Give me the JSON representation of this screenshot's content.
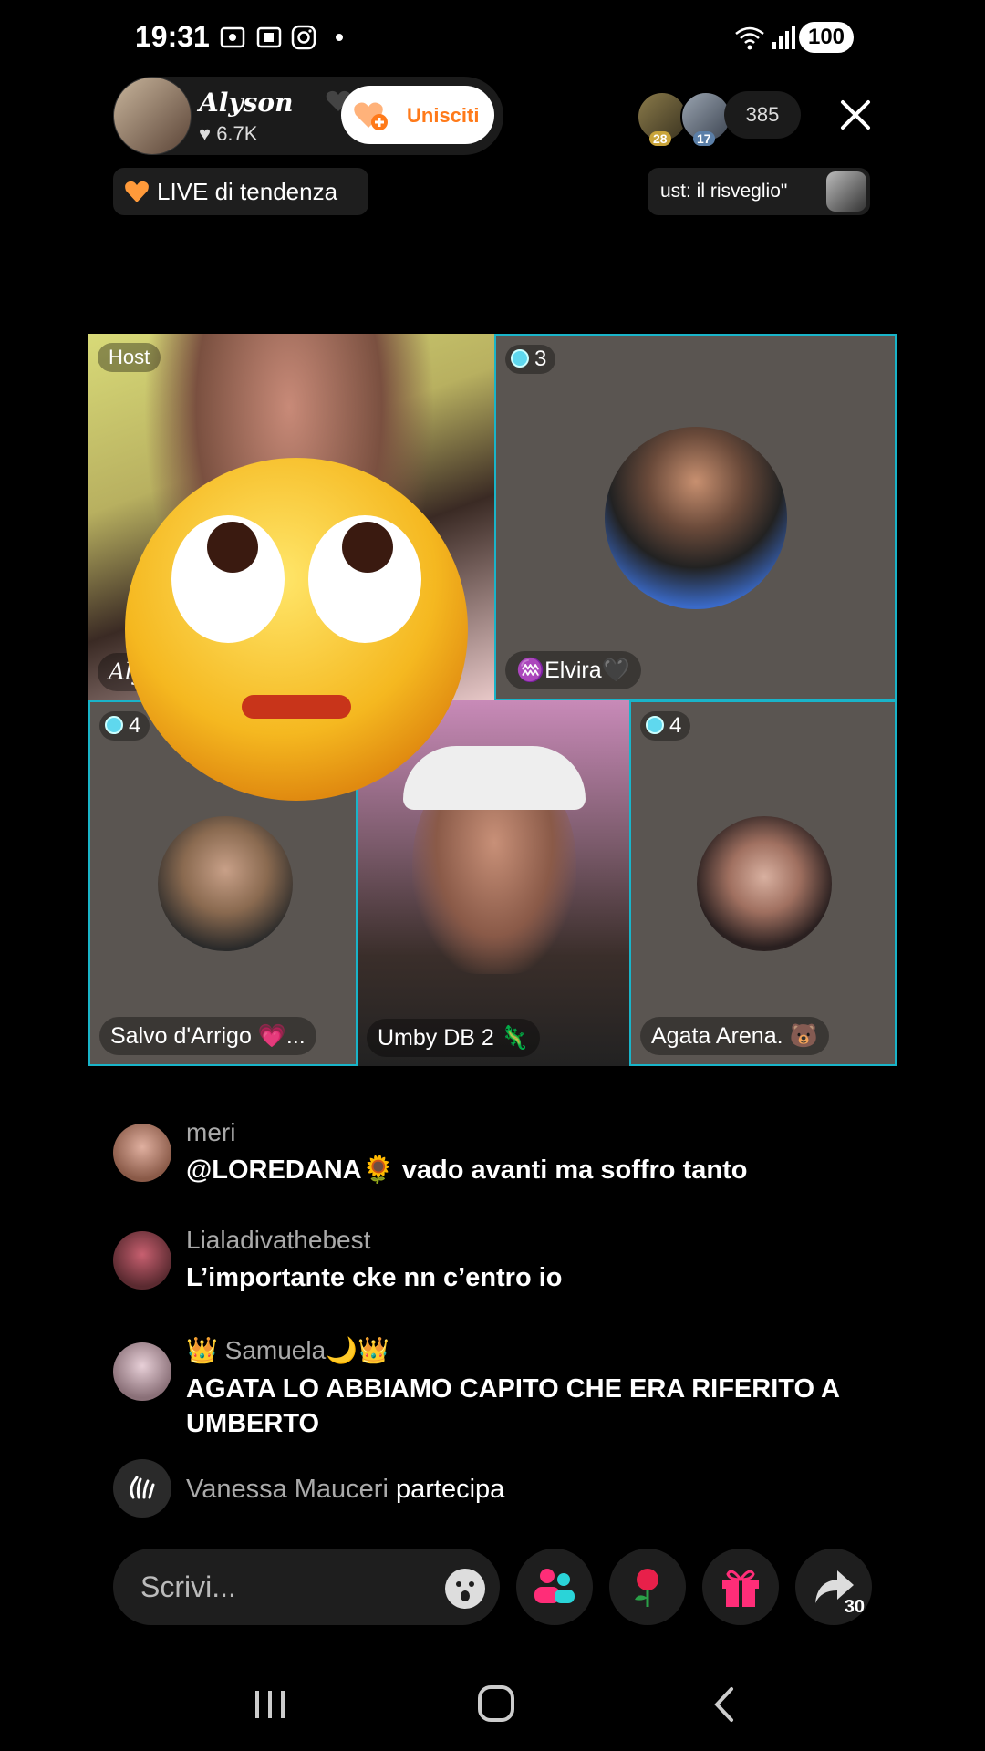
{
  "status_bar": {
    "time": "19:31",
    "battery": "100"
  },
  "host": {
    "name": "Alyson",
    "likes": "6.7K",
    "join_label": "Unisciti"
  },
  "viewers": {
    "avatars": [
      {
        "badge": "28",
        "badge_color": "#c9a43a"
      },
      {
        "badge": "17",
        "badge_color": "#5b7fa8"
      }
    ],
    "count": "385"
  },
  "tags": {
    "trending": "LIVE di tendenza",
    "live_title": "ust: il risveglio\""
  },
  "grid": {
    "host_label": "Host",
    "host_name_fragment": "Aly",
    "guests": [
      {
        "name": "♒Elvira🖤",
        "count": "3"
      },
      {
        "name": "Salvo d'Arrigo 💗...",
        "count": "4"
      },
      {
        "name": "Umby DB 2 🦎",
        "count": ""
      },
      {
        "name": "Agata Arena. 🐻",
        "count": "4"
      }
    ],
    "reaction_emoji": "🙄"
  },
  "chat": [
    {
      "user": "meri",
      "message": "@LOREDANA🌻 vado avanti ma soffro tanto"
    },
    {
      "user": "Lialadivathebest",
      "message": "L’importante cke nn c’entro io"
    },
    {
      "user": "👑 Samuela🌙👑",
      "message": "AGATA LO ABBIAMO CAPITO CHE ERA RIFERITO A UMBERTO"
    },
    {
      "user": "Vanessa Mauceri",
      "message": "partecipa"
    }
  ],
  "input": {
    "placeholder": "Scrivi..."
  },
  "share": {
    "count": "30"
  },
  "colors": {
    "accent_cyan": "#19b4c9",
    "join_orange": "#ff7a1a",
    "pink": "#ff2d78"
  }
}
